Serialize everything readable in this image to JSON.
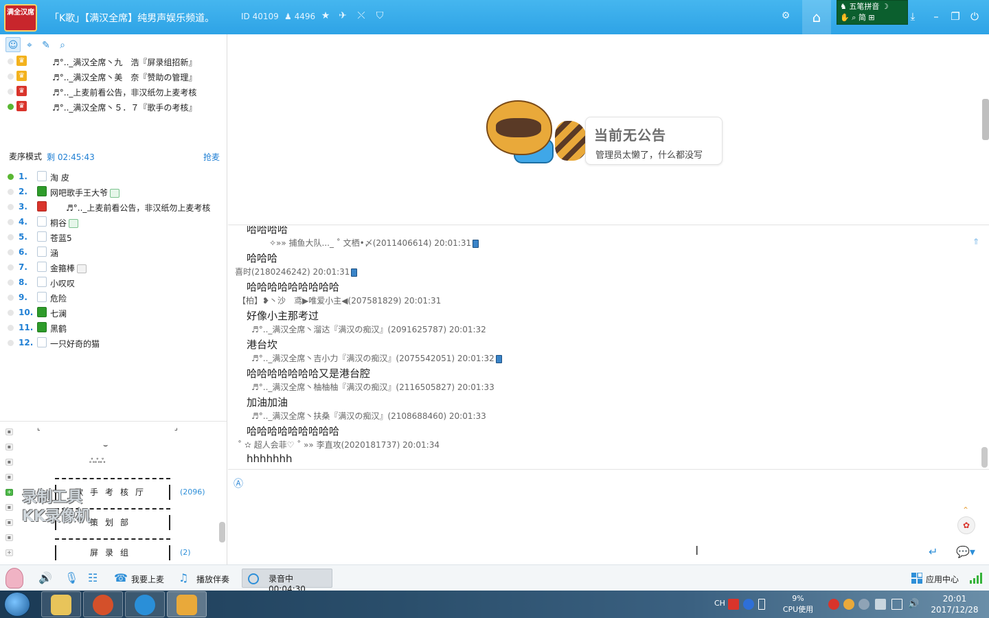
{
  "titlebar": {
    "logo_text": "满全汉席",
    "channel_title": "「K歌」【满汉全席】纯男声娱乐频道。",
    "channel_id": "ID 40109",
    "online_count": "4496",
    "ime": {
      "name": "五笔拼音",
      "mode": "简",
      "extra": "⊞"
    }
  },
  "left": {
    "tabs": [
      "user-tab",
      "location-tab",
      "edit-tab",
      "search-tab"
    ],
    "managers": [
      {
        "name": "♬°.._满汉全席丶九　浩『屏录组招新』",
        "role": "gold",
        "online": false
      },
      {
        "name": "♬°.._满汉全席丶美　奈『赞助の管理』",
        "role": "gold",
        "online": false
      },
      {
        "name": "♬°.._上麦前看公告，非汉纸勿上麦考核",
        "role": "red",
        "online": false
      },
      {
        "name": "♬°.._满汉全席丶５．７『歌手の考核』",
        "role": "red",
        "online": true
      }
    ],
    "queue": {
      "mode_label": "麦序模式",
      "remain": "剩 02:45:43",
      "grab_label": "抢麦",
      "items": [
        {
          "num": "1.",
          "name": "淘 皮",
          "icon": "empty",
          "online": true,
          "badge": ""
        },
        {
          "num": "2.",
          "name": "网吧歌手王大爷",
          "icon": "green",
          "online": false,
          "badge": "green"
        },
        {
          "num": "3.",
          "name": "♬°.._上麦前看公告，非汉纸勿上麦考核",
          "icon": "red",
          "online": false,
          "badge": ""
        },
        {
          "num": "4.",
          "name": "桐谷",
          "icon": "empty",
          "online": false,
          "badge": "green"
        },
        {
          "num": "5.",
          "name": "苍蓝5",
          "icon": "empty",
          "online": false,
          "badge": ""
        },
        {
          "num": "6.",
          "name": "涵",
          "icon": "empty",
          "online": false,
          "badge": ""
        },
        {
          "num": "7.",
          "name": "金箍棒",
          "icon": "empty",
          "online": false,
          "badge": "gray"
        },
        {
          "num": "8.",
          "name": "小叹叹",
          "icon": "empty",
          "online": false,
          "badge": ""
        },
        {
          "num": "9.",
          "name": "危险",
          "icon": "empty",
          "online": false,
          "badge": ""
        },
        {
          "num": "10.",
          "name": "七澜",
          "icon": "green",
          "online": false,
          "badge": ""
        },
        {
          "num": "11.",
          "name": "黑鹤",
          "icon": "green",
          "online": false,
          "badge": ""
        },
        {
          "num": "12.",
          "name": "一只好奇的猫",
          "icon": "empty",
          "online": false,
          "badge": ""
        }
      ]
    },
    "rooms": {
      "deco_line_1": "⌣",
      "deco_line_2": "ஃஃஃ",
      "room1_name": "歌手考核厅",
      "room1_count": "(2096)",
      "room2_name": "策划部",
      "room3_name": "屏录组",
      "room3_count": "(2)"
    },
    "watermark_line1": "录制工具",
    "watermark_line2": "KK录像机"
  },
  "announcement": {
    "title": "当前无公告",
    "subtitle": "管理员太懒了，什么都没写"
  },
  "chat": {
    "messages": [
      {
        "text": "哈哈哈哈",
        "meta": "✧»» 捕鱼大队..._ ˚ 文栖•〆(2011406614) 20:01:31"
      },
      {
        "text": "哈哈哈",
        "meta": "喜时(2180246242) 20:01:31"
      },
      {
        "text": "哈哈哈哈哈哈哈哈哈",
        "meta": "【柏】❥丶沙　鸢▶唯爱小主◀(207581829) 20:01:31"
      },
      {
        "text": "好像小主那考过",
        "meta": "♬°.._满汉全席丶溜达『满汉の痴汉』(2091625787) 20:01:32"
      },
      {
        "text": "港台坎",
        "meta": "♬°.._满汉全席丶吉小力『满汉の痴汉』(2075542051) 20:01:32"
      },
      {
        "text": "哈哈哈哈哈哈哈又是港台腔",
        "meta": "♬°.._满汉全席丶柚柚柚『满汉の痴汉』(2116505827) 20:01:33"
      },
      {
        "text": "加油加油",
        "meta": "♬°.._满汉全席丶扶桑『满汉の痴汉』(2108688460) 20:01:33"
      },
      {
        "text": "哈哈哈哈哈哈哈哈哈",
        "meta": "˚ ✫ 超人会菲♡ ˚ »» 李直攻(2020181737) 20:01:34"
      },
      {
        "text": "hhhhhhh",
        "meta": ""
      }
    ]
  },
  "bottombar": {
    "mic_label": "我要上麦",
    "music_label": "播放伴奏",
    "rec_label": "录音中 00:04:30",
    "apps_label": "应用中心"
  },
  "taskbar": {
    "lang": "CH",
    "cpu_value": "9%",
    "cpu_label": "CPU使用",
    "time": "20:01",
    "date": "2017/12/28"
  },
  "colors": {
    "title_bar": "#2ea3e6",
    "accent": "#1f7fd4",
    "red_role": "#d9342b",
    "gold_role": "#f3b21d"
  }
}
